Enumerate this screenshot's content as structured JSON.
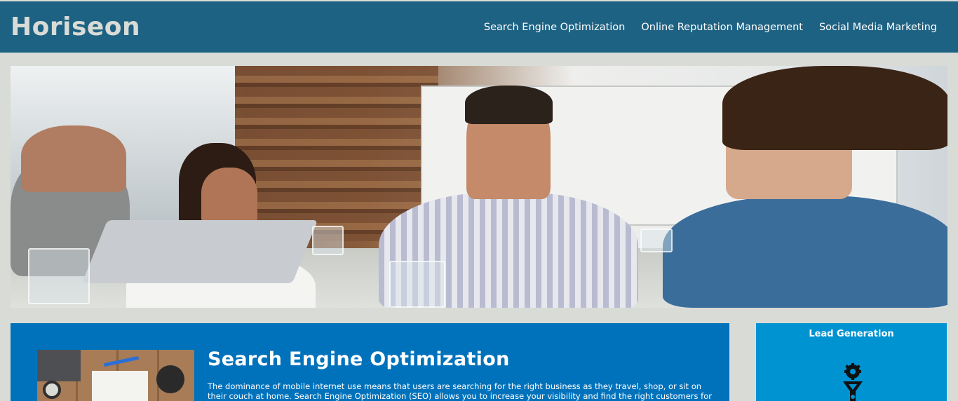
{
  "header": {
    "logo": "Horiseon",
    "nav": [
      {
        "label": "Search Engine Optimization"
      },
      {
        "label": "Online Reputation Management"
      },
      {
        "label": "Social Media Marketing"
      }
    ]
  },
  "content": {
    "seo": {
      "title": "Search Engine Optimization",
      "text": "The dominance of mobile internet use means that users are searching for the right business as they travel, shop, or sit on their couch at home. Search Engine Optimization (SEO) allows you to increase your visibility and find the right customers for your"
    }
  },
  "sidebar": {
    "benefit_title": "Lead Generation"
  },
  "colors": {
    "header_bg": "#1e6283",
    "page_bg": "#d9dcd6",
    "section_bg": "#0072bb",
    "benefit_bg": "#0093d2"
  }
}
